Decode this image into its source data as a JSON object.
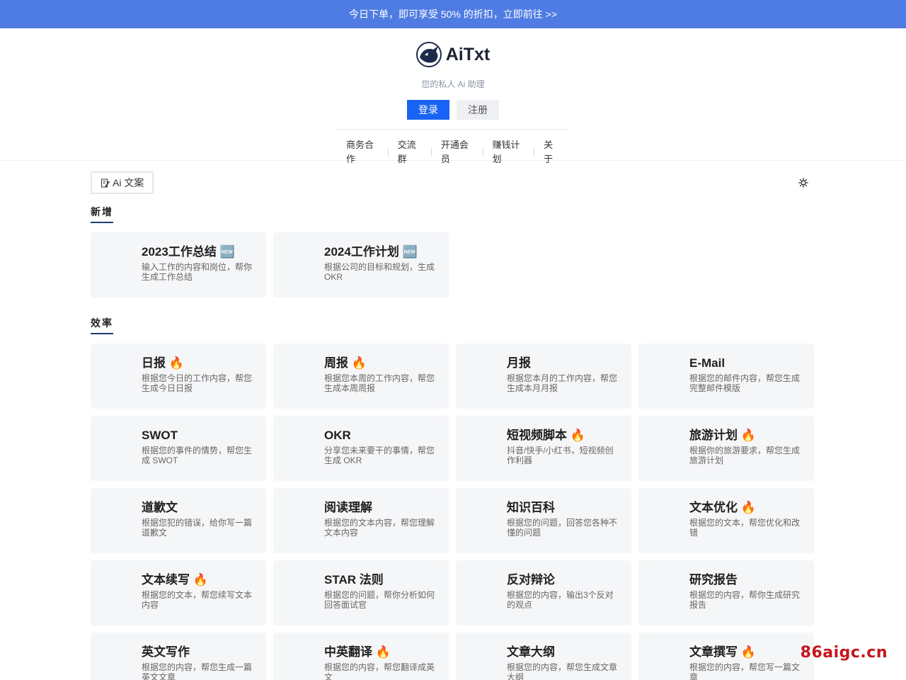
{
  "promo": {
    "text": "今日下单，即可享受 50% 的折扣，立即前往 >>"
  },
  "brand": {
    "name": "AiTxt",
    "tagline": "您的私人 Ai 助理"
  },
  "auth": {
    "login": "登录",
    "register": "注册"
  },
  "nav": [
    "商务合作",
    "交流群",
    "开通会员",
    "赚钱计划",
    "关于"
  ],
  "toolbar": {
    "tag": "Ai 文案"
  },
  "sections": [
    {
      "title": "新增",
      "cards": [
        {
          "title": "2023工作总结 🆕",
          "desc": "输入工作的内容和岗位，帮你生成工作总结"
        },
        {
          "title": "2024工作计划 🆕",
          "desc": "根据公司的目标和规划，生成 OKR"
        }
      ]
    },
    {
      "title": "效率",
      "cards": [
        {
          "title": "日报 🔥",
          "desc": "根据您今日的工作内容，帮您生成今日日报"
        },
        {
          "title": "周报 🔥",
          "desc": "根据您本周的工作内容，帮您生成本周周报"
        },
        {
          "title": "月报",
          "desc": "根据您本月的工作内容，帮您生成本月月报"
        },
        {
          "title": "E-Mail",
          "desc": "根据您的邮件内容，帮您生成完整邮件模版"
        },
        {
          "title": "SWOT",
          "desc": "根据您的事件的情势，帮您生成 SWOT"
        },
        {
          "title": "OKR",
          "desc": "分享您未来要干的事情，帮您生成 OKR"
        },
        {
          "title": "短视频脚本 🔥",
          "desc": "抖音/快手/小红书，短视频创作利器"
        },
        {
          "title": "旅游计划 🔥",
          "desc": "根据你的旅游要求，帮您生成旅游计划"
        },
        {
          "title": "道歉文",
          "desc": "根据您犯的错误，给你写一篇道歉文"
        },
        {
          "title": "阅读理解",
          "desc": "根据您的文本内容，帮您理解文本内容"
        },
        {
          "title": "知识百科",
          "desc": "根据您的问题，回答您各种不懂的问题"
        },
        {
          "title": "文本优化 🔥",
          "desc": "根据您的文本，帮您优化和改错"
        },
        {
          "title": "文本续写 🔥",
          "desc": "根据您的文本，帮您续写文本内容"
        },
        {
          "title": "STAR 法则",
          "desc": "根据您的问题，帮你分析如何回答面试官"
        },
        {
          "title": "反对辩论",
          "desc": "根据您的内容，输出3个反对的观点"
        },
        {
          "title": "研究报告",
          "desc": "根据您的内容，帮你生成研究报告"
        },
        {
          "title": "英文写作",
          "desc": "根据您的内容，帮您生成一篇英文文章"
        },
        {
          "title": "中英翻译 🔥",
          "desc": "根据您的内容，帮您翻译成英文"
        },
        {
          "title": "文章大纲",
          "desc": "根据您的内容，帮您生成文章大纲"
        },
        {
          "title": "文章撰写 🔥",
          "desc": "根据您的内容，帮您写一篇文章"
        }
      ]
    }
  ],
  "watermark": "86aigc.cn",
  "icons": {
    "logo": "rhino-logo-icon",
    "tag": "edit-note-icon",
    "theme": "sun-icon"
  },
  "colors": {
    "promo": "#4f7ce3",
    "primary": "#1a63f4",
    "card": "#f5f6f8",
    "watermark": "#c4161c"
  }
}
